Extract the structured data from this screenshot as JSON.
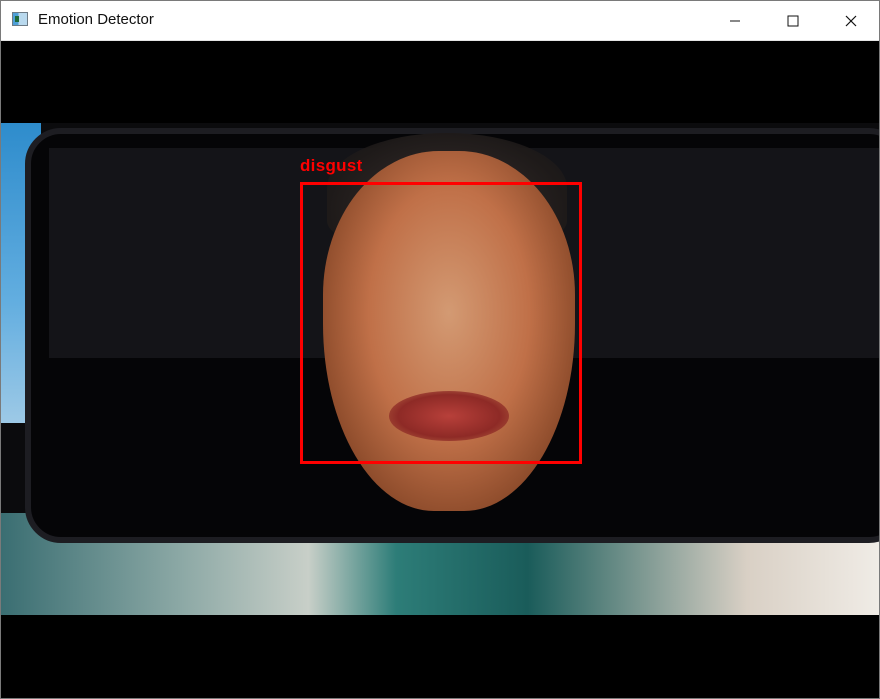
{
  "window": {
    "title": "Emotion Detector",
    "icon": "app-icon",
    "controls": {
      "minimize": "minimize-icon",
      "maximize": "maximize-icon",
      "close": "close-icon"
    }
  },
  "detection": {
    "label": "disgust",
    "box_color": "#ff0000"
  }
}
